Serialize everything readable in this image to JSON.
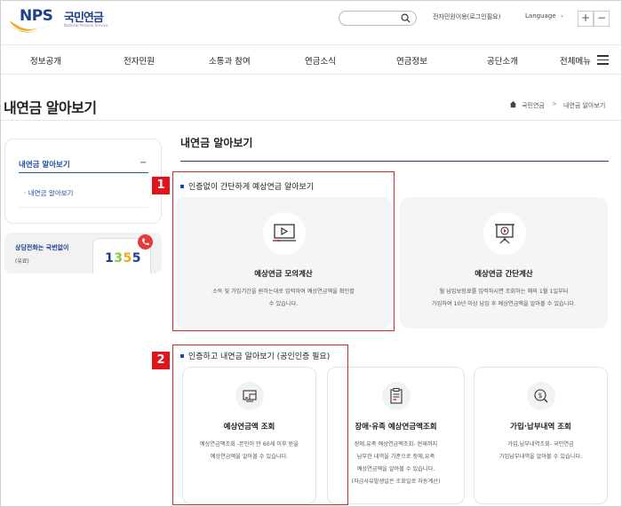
{
  "header": {
    "logo_text": "NPS",
    "logo_kr": "국민연금",
    "logo_sub": "National Pension Service",
    "util_link": "전자민원이용(로그인필요)",
    "language": "Language",
    "zoom_in": "+",
    "zoom_out": "−"
  },
  "gnb": {
    "items": [
      "정보공개",
      "전자민원",
      "소통과 참여",
      "연금소식",
      "연금정보",
      "공단소개",
      "전체메뉴"
    ]
  },
  "page": {
    "title": "내연금 알아보기",
    "breadcrumb": {
      "home": "국민연금",
      "separator": ">",
      "current": "내연금 알아보기"
    }
  },
  "lnb": {
    "head": "내연금 알아보기",
    "toggle": "−",
    "sub": "· 내연금 알아보기"
  },
  "call": {
    "title": "상담전화는 국번없이",
    "sub": "(유료)",
    "number": "1355"
  },
  "main": {
    "title": "내연금 알아보기",
    "badge1": "1",
    "badge2": "2",
    "section1_title": "인증없이 간단하게 예상연금 알아보기",
    "section2_title": "인증하고 내연금 알아보기 (공인인증 필요)",
    "cards1": [
      {
        "title": "예상연금 모의계산",
        "desc": "소득 및 가입기간을 원하는대로 입력하여 예상연금액을 확인할\n수 있습니다."
      },
      {
        "title": "예상연금 간단계산",
        "desc": "월 납입보험료를 입력하시면 조회하는 해의 1월 1일부터\n가입하여 10년 이상 납입 후 예상연금액을 알아볼 수 있습니다."
      }
    ],
    "cards2": [
      {
        "title": "예상연금액 조회",
        "desc": "예상연금액조회 -본인이 만 60세 이후 받을\n예상연금액을 알아볼 수 있습니다."
      },
      {
        "title": "장애·유족 예상연금액조회",
        "desc": "장애,유족 예상연금액조회- 현재까지\n납부한 내역을 기준으로 장애,유족\n예상연금액을 알아볼 수 있습니다.\n(자금사유발생일은 조회일로 자동계산)"
      },
      {
        "title": "가입·납부내역 조회",
        "desc": "가입,납부내역조회- 국민연금\n가입납부내역을 알아볼 수 있습니다."
      }
    ]
  },
  "colors": {
    "brand_blue": "#1f3e8c",
    "highlight_red": "#e1141c",
    "accent_green": "#8dc63f",
    "accent_orange": "#f5a623"
  }
}
